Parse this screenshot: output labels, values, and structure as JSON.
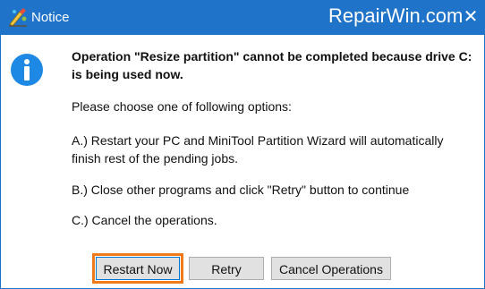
{
  "window": {
    "title": "Notice",
    "watermark": "RepairWin.com",
    "close_glyph": "✕",
    "app_icon": "minitool-wizard-icon"
  },
  "message": {
    "icon": "info-icon",
    "heading": "Operation \"Resize partition\" cannot be completed because drive C: is being used now.",
    "prompt": "Please choose one of following options:",
    "option_a": "A.) Restart your PC and MiniTool Partition Wizard will automatically finish rest of the pending jobs.",
    "option_b": "B.) Close other programs and click \"Retry\" button to continue",
    "option_c": "C.) Cancel the operations."
  },
  "buttons": {
    "restart": "Restart Now",
    "retry": "Retry",
    "cancel": "Cancel Operations"
  },
  "colors": {
    "titlebar": "#1f73c9",
    "info_icon": "#1e88e5",
    "highlight": "#f07a1a"
  }
}
